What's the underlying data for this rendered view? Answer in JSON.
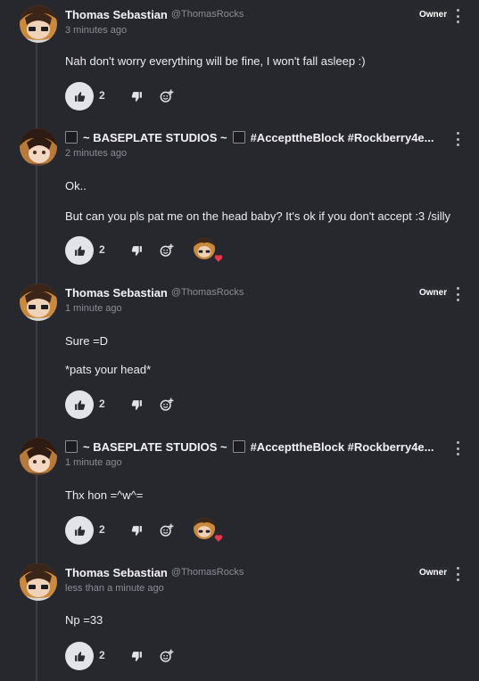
{
  "colors": {
    "background": "#27272e",
    "text": "#ececf1",
    "muted": "#8c8c96",
    "heart": "#e8384f",
    "like_button_bg": "#e3e3ea"
  },
  "icons": {
    "like": "thumbs-up-icon",
    "dislike": "thumbs-down-icon",
    "react": "add-reaction-icon",
    "more": "kebab-menu-icon",
    "reaction_heart": "heart-icon"
  },
  "comments": [
    {
      "author": "Thomas Sebastian",
      "handle": "@ThomasRocks",
      "time": "3 minutes ago",
      "badge": "Owner",
      "lines": [
        "Nah don't worry everything will be fine, I won't fall asleep :)"
      ],
      "likes": "2"
    },
    {
      "author_part1": "~ BASEPLATE STUDIOS ~",
      "author_part2": "#AccepttheBlock #Rockberry4e...",
      "time": "2 minutes ago",
      "lines": [
        "Ok..",
        "But can you pls pat me on the head baby? It's ok if you don't accept :3 /silly"
      ],
      "likes": "2",
      "reaction": "heart-icon"
    },
    {
      "author": "Thomas Sebastian",
      "handle": "@ThomasRocks",
      "time": "1 minute ago",
      "badge": "Owner",
      "lines": [
        "Sure =D",
        "*pats your head*"
      ],
      "likes": "2"
    },
    {
      "author_part1": "~ BASEPLATE STUDIOS ~",
      "author_part2": "#AccepttheBlock #Rockberry4e...",
      "time": "1 minute ago",
      "lines": [
        "Thx hon =^w^="
      ],
      "likes": "2",
      "reaction": "heart-icon"
    },
    {
      "author": "Thomas Sebastian",
      "handle": "@ThomasRocks",
      "time": "less than a minute ago",
      "badge": "Owner",
      "lines": [
        "Np =33"
      ],
      "likes": "2"
    }
  ]
}
